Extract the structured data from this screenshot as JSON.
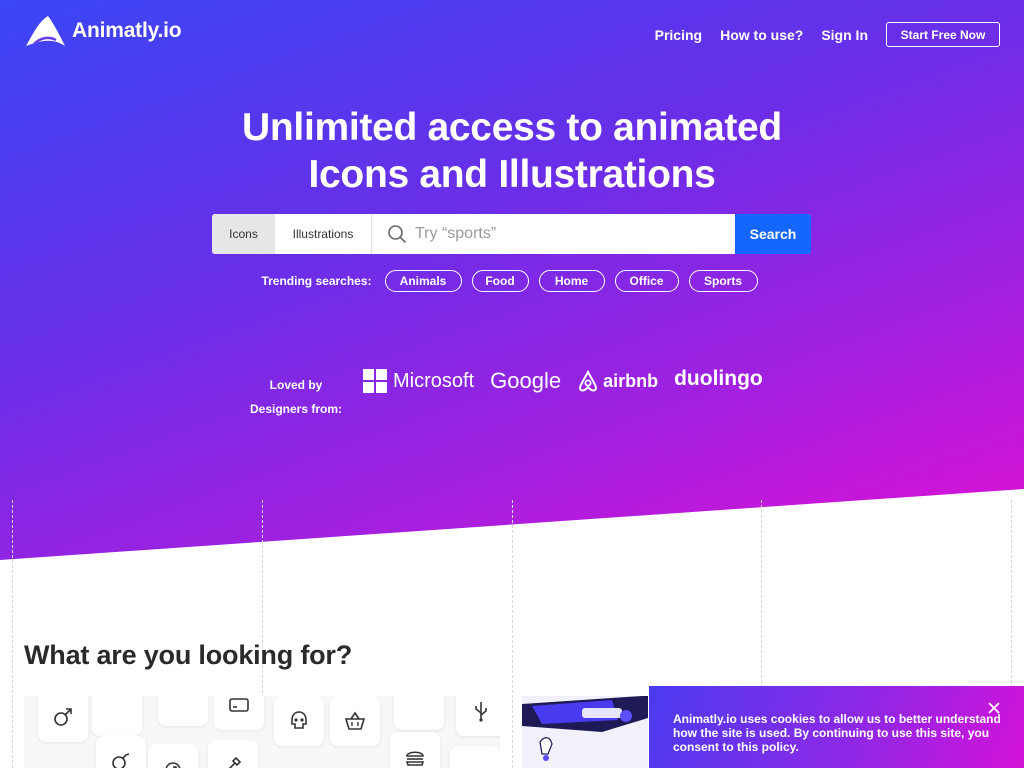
{
  "brand": {
    "name": "Animatly.io"
  },
  "nav": {
    "links": [
      "Pricing",
      "How to use?",
      "Sign In"
    ],
    "cta": "Start Free Now"
  },
  "hero": {
    "line1": "Unlimited access to animated",
    "line2": "Icons and Illustrations"
  },
  "search": {
    "tabs": [
      "Icons",
      "Illustrations"
    ],
    "active_tab": "Icons",
    "placeholder": "Try “sports”",
    "button": "Search"
  },
  "trending": {
    "label": "Trending searches:",
    "tags": [
      "Animals",
      "Food",
      "Home",
      "Office",
      "Sports"
    ]
  },
  "loved": {
    "line1": "Loved by",
    "line2": "Designers from:",
    "brands": [
      "Microsoft",
      "Google",
      "airbnb",
      "duolingo"
    ]
  },
  "section": {
    "title": "What are you looking for?"
  },
  "cookie": {
    "text": "Animatly.io uses cookies to allow us to better understand how the site is used. By continuing to use this site, you consent to this policy."
  },
  "colors": {
    "hero_start": "#3a46f5",
    "hero_end": "#e210d4",
    "search_button": "#1565ff"
  },
  "icons": [
    "logo-icon",
    "search-icon",
    "microsoft-logo-icon",
    "airbnb-logo-icon",
    "close-icon",
    "gender-male-icon",
    "skull-icon",
    "basket-icon",
    "usb-icon",
    "burger-icon"
  ]
}
